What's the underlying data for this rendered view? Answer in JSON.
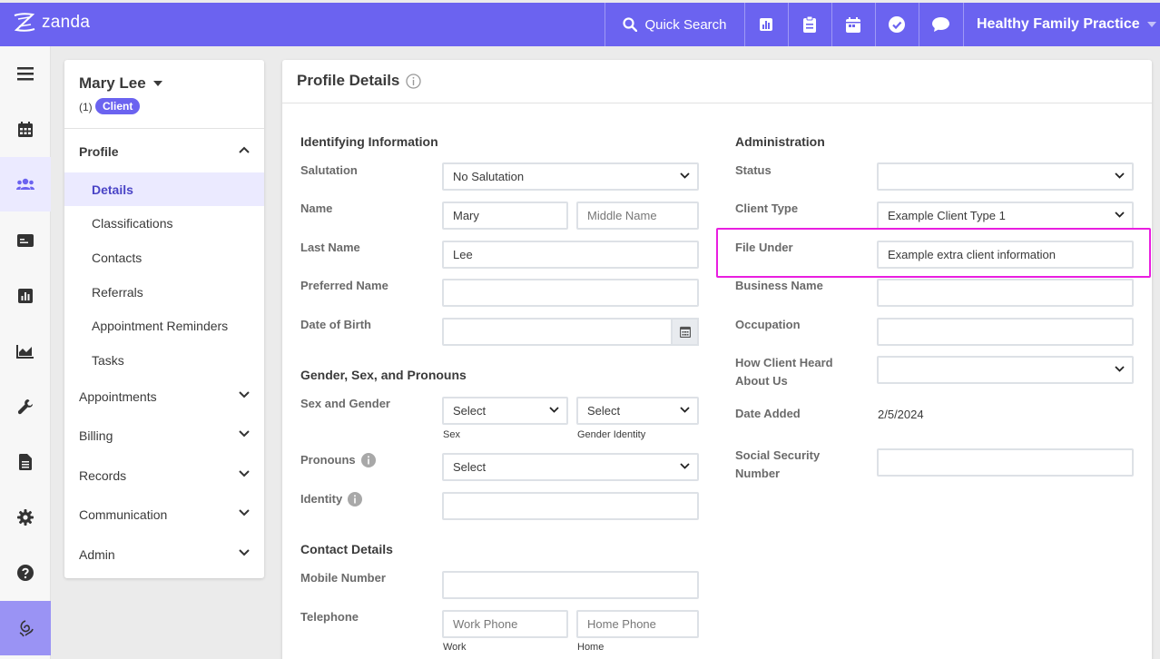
{
  "topbar": {
    "logo_text": "zanda",
    "quick_search_label": "Quick Search",
    "icons": [
      "reports-icon",
      "clipboard-icon",
      "calendar-icon",
      "check-circle-icon",
      "chat-icon"
    ],
    "practice_name": "Healthy Family Practice",
    "accent_color": "#6b63f0"
  },
  "rail": {
    "items": [
      "menu-icon",
      "calendar-icon",
      "clients-icon",
      "billing-card-icon",
      "reports-icon",
      "chart-icon",
      "wrench-icon",
      "document-icon",
      "gear-icon",
      "help-icon",
      "brand-icon"
    ],
    "active": "clients-icon"
  },
  "profile": {
    "name": "Mary Lee",
    "count": "(1)",
    "badge": "Client",
    "nav": {
      "profile_label": "Profile",
      "sub_items": [
        "Details",
        "Classifications",
        "Contacts",
        "Referrals",
        "Appointment Reminders",
        "Tasks"
      ],
      "active_sub": "Details",
      "sections": [
        "Appointments",
        "Billing",
        "Records",
        "Communication",
        "Admin"
      ]
    }
  },
  "main": {
    "title": "Profile Details",
    "identifying": {
      "title": "Identifying Information",
      "salutation_label": "Salutation",
      "salutation_value": "No Salutation",
      "name_label": "Name",
      "first_name_value": "Mary",
      "middle_name_placeholder": "Middle Name",
      "last_name_label": "Last Name",
      "last_name_value": "Lee",
      "preferred_name_label": "Preferred Name",
      "dob_label": "Date of Birth"
    },
    "gender": {
      "title": "Gender, Sex, and Pronouns",
      "sex_gender_label": "Sex and Gender",
      "sex_value": "Select",
      "sex_sublabel": "Sex",
      "gender_identity_value": "Select",
      "gender_identity_sublabel": "Gender Identity",
      "pronouns_label": "Pronouns",
      "pronouns_value": "Select",
      "identity_label": "Identity"
    },
    "contact": {
      "title": "Contact Details",
      "mobile_label": "Mobile Number",
      "telephone_label": "Telephone",
      "work_placeholder": "Work Phone",
      "work_sublabel": "Work",
      "home_placeholder": "Home Phone",
      "home_sublabel": "Home"
    },
    "administration": {
      "title": "Administration",
      "status_label": "Status",
      "status_value": "",
      "client_type_label": "Client Type",
      "client_type_value": "Example Client Type 1",
      "file_under_label": "File Under",
      "file_under_value": "Example extra client information",
      "business_name_label": "Business Name",
      "occupation_label": "Occupation",
      "how_heard_label_line1": "How Client Heard",
      "how_heard_label_line2": "About Us",
      "date_added_label": "Date Added",
      "date_added_value": "2/5/2024",
      "ssn_label_line1": "Social Security",
      "ssn_label_line2": "Number"
    },
    "highlight_color": "#e91ee0"
  }
}
